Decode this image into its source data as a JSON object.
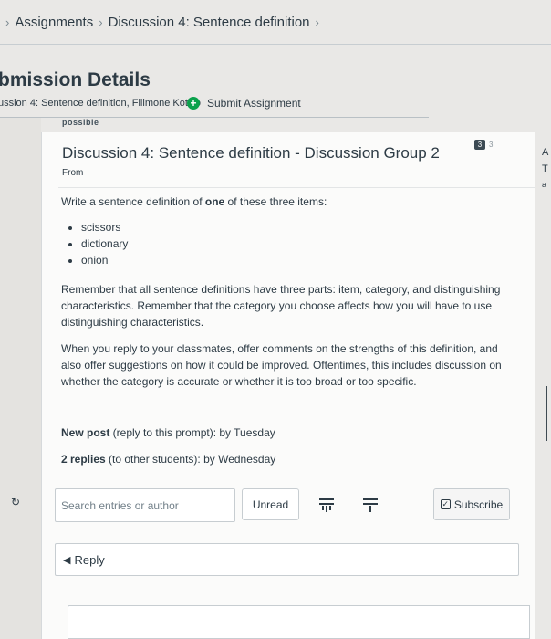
{
  "breadcrumb": {
    "items": [
      "Assignments",
      "Discussion 4: Sentence definition"
    ]
  },
  "header": {
    "title": "bmission Details",
    "subline": "ussion 4: Sentence definition, Filimone Kotiso",
    "submit_label": "Submit Assignment",
    "cut_label": "possible"
  },
  "right_strip": {
    "letters": [
      "A",
      "T",
      "a"
    ]
  },
  "discussion": {
    "title": "Discussion 4: Sentence definition - Discussion Group 2",
    "badge_count": "3",
    "badge_total": "3",
    "from_label": "From",
    "prompt_pre": "Write a sentence definition of ",
    "prompt_bold": "one",
    "prompt_post": " of these three items:",
    "items": [
      "scissors",
      "dictionary",
      "onion"
    ],
    "paragraph1": "Remember that all sentence definitions have three parts: item, category, and distinguishing characteristics. Remember that the category you choose affects how you will have to use distinguishing characteristics.",
    "paragraph2": "When you reply to your classmates, offer comments on the strengths of this definition, and also offer suggestions on how it could be improved. Oftentimes, this includes discussion on whether the category is accurate or whether it is too broad or too specific.",
    "due1_bold": "New post",
    "due1_rest": " (reply to this prompt): by Tuesday",
    "due2_bold": "2 replies",
    "due2_rest": " (to other students): by Wednesday"
  },
  "controls": {
    "search_placeholder": "Search entries or author",
    "unread_label": "Unread",
    "subscribe_label": "Subscribe",
    "reply_label": "Reply"
  },
  "colors": {
    "accent_green": "#0aa14b",
    "text": "#2d3b45",
    "border": "#c7cdd1"
  }
}
